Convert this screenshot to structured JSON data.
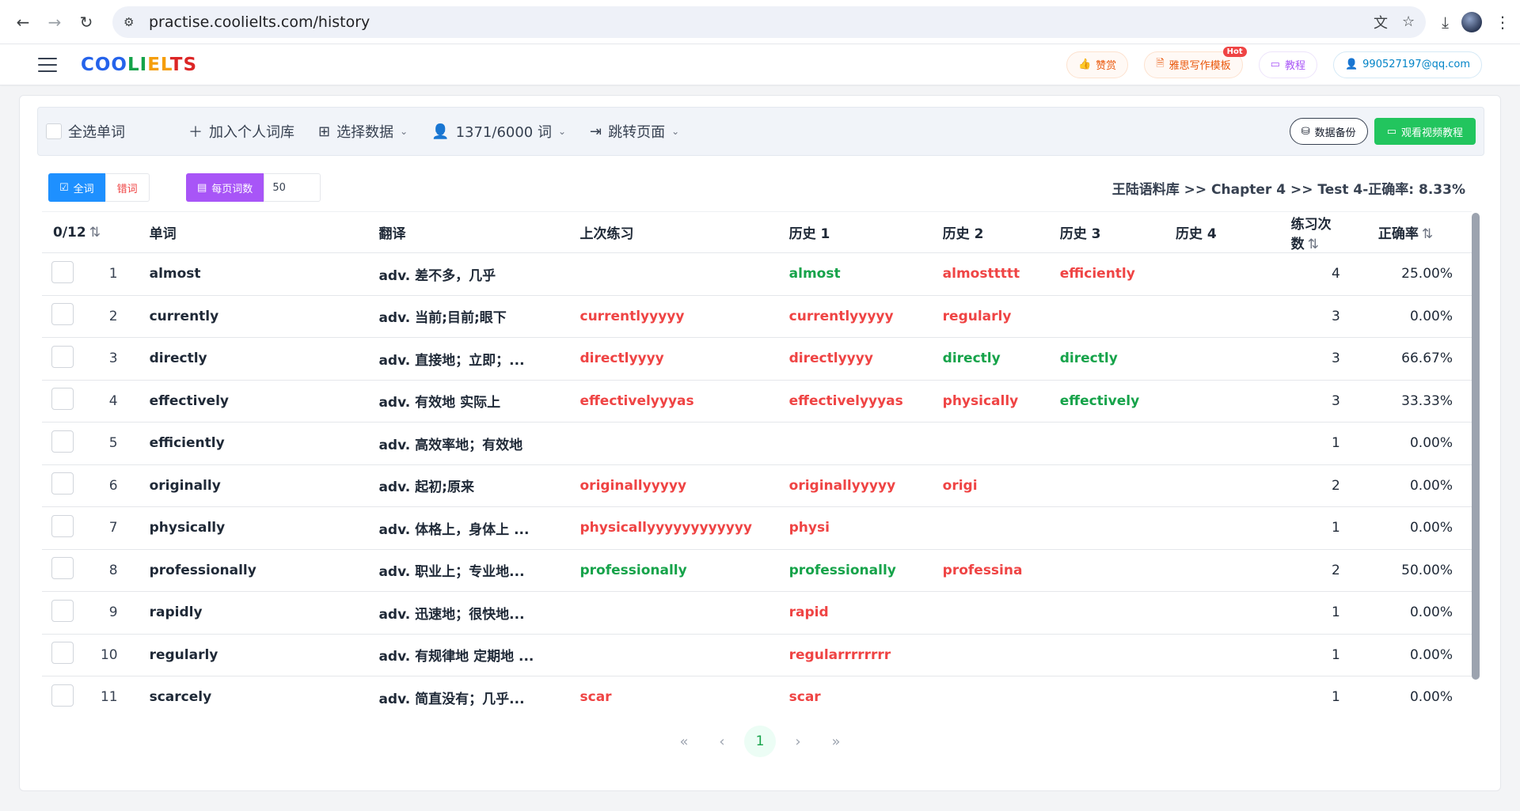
{
  "browser": {
    "url": "practise.coolielts.com/history"
  },
  "header": {
    "logo": [
      "COO",
      "LI",
      "EL",
      "TS"
    ],
    "actions": {
      "praise": "赞赏",
      "template": "雅思写作模板",
      "hot_badge": "Hot",
      "tutorial": "教程",
      "account": "990527197@qq.com"
    }
  },
  "toolbar": {
    "select_all": "全选单词",
    "add_vocab": "加入个人词库",
    "select_data": "选择数据",
    "word_count": "1371/6000 词",
    "jump_page": "跳转页面",
    "backup": "数据备份",
    "watch_video": "观看视频教程"
  },
  "filters": {
    "all_words": "全词",
    "wrong_words": "错词",
    "per_page_label": "每页词数",
    "per_page_value": "50"
  },
  "status": "王陆语料库 >> Chapter 4 >> Test 4-正确率: 8.33%",
  "table": {
    "headers": {
      "selected": "0/12",
      "word": "单词",
      "translation": "翻译",
      "last": "上次练习",
      "h1": "历史 1",
      "h2": "历史 2",
      "h3": "历史 3",
      "h4": "历史 4",
      "count": "练习次数",
      "accuracy": "正确率"
    },
    "rows": [
      {
        "no": "1",
        "word": "almost",
        "trans": "adv. 差不多，几乎",
        "last": "",
        "last_c": "",
        "h1": "almost",
        "h1_c": "green",
        "h2": "almosttttt",
        "h2_c": "red",
        "h3": "efficiently",
        "h3_c": "red",
        "h4": "",
        "count": "4",
        "acc": "25.00%"
      },
      {
        "no": "2",
        "word": "currently",
        "trans": "adv. 当前;目前;眼下",
        "last": "currentlyyyyy",
        "last_c": "red",
        "h1": "currentlyyyyy",
        "h1_c": "red",
        "h2": "regularly",
        "h2_c": "red",
        "h3": "",
        "h3_c": "",
        "h4": "",
        "count": "3",
        "acc": "0.00%"
      },
      {
        "no": "3",
        "word": "directly",
        "trans": "adv. 直接地；立即；...",
        "last": "directlyyyy",
        "last_c": "red",
        "h1": "directlyyyy",
        "h1_c": "red",
        "h2": "directly",
        "h2_c": "green",
        "h3": "directly",
        "h3_c": "green",
        "h4": "",
        "count": "3",
        "acc": "66.67%"
      },
      {
        "no": "4",
        "word": "effectively",
        "trans": "adv. 有效地 实际上",
        "last": "effectivelyyyas",
        "last_c": "red",
        "h1": "effectivelyyyas",
        "h1_c": "red",
        "h2": "physically",
        "h2_c": "red",
        "h3": "effectively",
        "h3_c": "green",
        "h4": "",
        "count": "3",
        "acc": "33.33%"
      },
      {
        "no": "5",
        "word": "efficiently",
        "trans": "adv. 高效率地；有效地",
        "last": "",
        "last_c": "",
        "h1": "",
        "h1_c": "",
        "h2": "",
        "h2_c": "",
        "h3": "",
        "h3_c": "",
        "h4": "",
        "count": "1",
        "acc": "0.00%"
      },
      {
        "no": "6",
        "word": "originally",
        "trans": "adv. 起初;原来",
        "last": "originallyyyyy",
        "last_c": "red",
        "h1": "originallyyyyy",
        "h1_c": "red",
        "h2": "origi",
        "h2_c": "red",
        "h3": "",
        "h3_c": "",
        "h4": "",
        "count": "2",
        "acc": "0.00%"
      },
      {
        "no": "7",
        "word": "physically",
        "trans": "adv. 体格上，身体上 ...",
        "last": "physicallyyyyyyyyyyyy",
        "last_c": "red",
        "h1": "physi",
        "h1_c": "red",
        "h2": "",
        "h2_c": "",
        "h3": "",
        "h3_c": "",
        "h4": "",
        "count": "1",
        "acc": "0.00%"
      },
      {
        "no": "8",
        "word": "professionally",
        "trans": "adv. 职业上；专业地...",
        "last": "professionally",
        "last_c": "green",
        "h1": "professionally",
        "h1_c": "green",
        "h2": "professina",
        "h2_c": "red",
        "h3": "",
        "h3_c": "",
        "h4": "",
        "count": "2",
        "acc": "50.00%"
      },
      {
        "no": "9",
        "word": "rapidly",
        "trans": "adv. 迅速地；很快地...",
        "last": "",
        "last_c": "",
        "h1": "rapid",
        "h1_c": "red",
        "h2": "",
        "h2_c": "",
        "h3": "",
        "h3_c": "",
        "h4": "",
        "count": "1",
        "acc": "0.00%"
      },
      {
        "no": "10",
        "word": "regularly",
        "trans": "adv. 有规律地 定期地 ...",
        "last": "",
        "last_c": "",
        "h1": "regularrrrrrrr",
        "h1_c": "red",
        "h2": "",
        "h2_c": "",
        "h3": "",
        "h3_c": "",
        "h4": "",
        "count": "1",
        "acc": "0.00%"
      },
      {
        "no": "11",
        "word": "scarcely",
        "trans": "adv. 简直没有；几乎...",
        "last": "scar",
        "last_c": "red",
        "h1": "scar",
        "h1_c": "red",
        "h2": "",
        "h2_c": "",
        "h3": "",
        "h3_c": "",
        "h4": "",
        "count": "1",
        "acc": "0.00%"
      }
    ]
  },
  "pagination": {
    "first": "«",
    "prev": "‹",
    "current": "1",
    "next": "›",
    "last": "»"
  },
  "colors": {
    "red": "#ef4444",
    "green": "#16a34a",
    "blue": "#1e90ff",
    "purple": "#a855f7",
    "success": "#22c55e"
  }
}
